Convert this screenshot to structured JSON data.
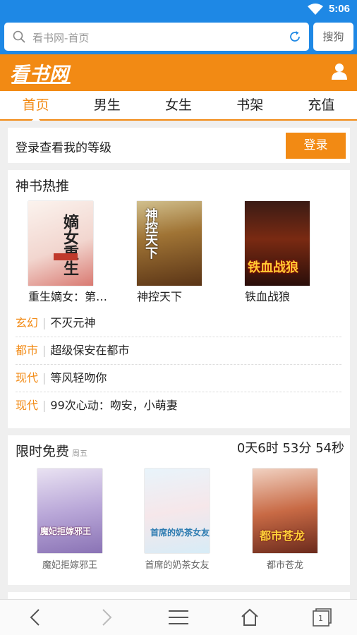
{
  "status": {
    "time": "5:06"
  },
  "browser": {
    "url_text": "看书网-首页",
    "search_button": "搜狗"
  },
  "site": {
    "logo_text": "看书网"
  },
  "tabs": [
    "首页",
    "男生",
    "女生",
    "书架",
    "充值"
  ],
  "login": {
    "prompt": "登录查看我的等级",
    "button": "登录"
  },
  "hot": {
    "title": "神书热推",
    "books": [
      {
        "name": "重生嫡女：第…",
        "cover_text": "嫡女重生"
      },
      {
        "name": "神控天下",
        "cover_text": "神控天下"
      },
      {
        "name": "铁血战狼",
        "cover_text": "铁血战狼"
      }
    ],
    "genres": [
      {
        "genre": "玄幻",
        "title": "不灭元神"
      },
      {
        "genre": "都市",
        "title": "超级保安在都市"
      },
      {
        "genre": "现代",
        "title": "等风轻吻你"
      },
      {
        "genre": "现代",
        "title": "99次心动：吻安，小萌妻"
      }
    ]
  },
  "free": {
    "title": "限时免费",
    "day": "周五",
    "countdown": "0天6时 53分 54秒",
    "books": [
      {
        "name": "魔妃拒嫁邪王",
        "cover_text": "魔妃拒嫁邪王"
      },
      {
        "name": "首席的奶茶女友",
        "cover_text": "首席的奶茶女友"
      },
      {
        "name": "都市苍龙",
        "cover_text": "都市苍龙"
      }
    ]
  },
  "bottom": {
    "tab_count": "1"
  },
  "colors": {
    "accent": "#f28a14",
    "browser_blue": "#1e88e5"
  }
}
